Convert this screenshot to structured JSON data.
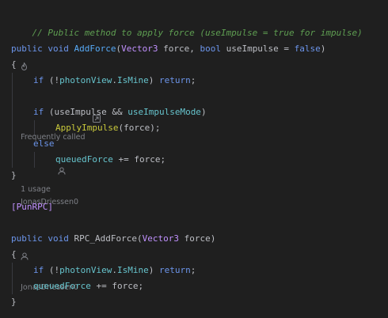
{
  "code": {
    "comment": "// Public method to apply force (useImpulse = true for impulse)",
    "hint1": {
      "frequently_called": "Frequently called",
      "usages": "1 usage",
      "author": "JonasDriessen0"
    },
    "l1": {
      "t1": "public",
      "t2": "void",
      "t3": "AddForce",
      "t4": "(",
      "t5": "Vector3",
      "t6": " force, ",
      "t7": "bool",
      "t8": " useImpulse = ",
      "t9": "false",
      "t10": ")"
    },
    "l2": "{",
    "l3": {
      "t1": "if",
      "t2": " (!",
      "t3": "photonView",
      "t4": ".",
      "t5": "IsMine",
      "t6": ") ",
      "t7": "return",
      "t8": ";"
    },
    "l4": {
      "t1": "if",
      "t2": " (useImpulse && ",
      "t3": "useImpulseMode",
      "t4": ")"
    },
    "l5": {
      "t1": "ApplyImpulse",
      "t2": "(force);"
    },
    "l6": "else",
    "l7": {
      "t1": "queuedForce",
      "t2": " += ",
      "t3": "force;"
    },
    "l8": "}",
    "l9": "[PunRPC]",
    "hint2": {
      "author": "JonasDriessen0"
    },
    "l10": {
      "t1": "public",
      "t2": "void",
      "t3": "RPC_AddForce",
      "t4": "(",
      "t5": "Vector3",
      "t6": " force)"
    },
    "l11": "{",
    "l12": {
      "t1": "if",
      "t2": " (!",
      "t3": "photonView",
      "t4": ".",
      "t5": "IsMine",
      "t6": ") ",
      "t7": "return",
      "t8": ";"
    },
    "l13": {
      "t1": "queuedForce",
      "t2": " += ",
      "t3": "force;"
    },
    "l14": "}"
  },
  "icons": {
    "frequently_called": "flame-icon",
    "usages": "usages-icon",
    "author": "person-icon"
  },
  "colors": {
    "background": "#1f1f1f",
    "comment": "#5f9f52",
    "keyword": "#cf8e6d",
    "type": "#c191ff",
    "method": "#57aaf7",
    "field": "#66c3cc"
  }
}
